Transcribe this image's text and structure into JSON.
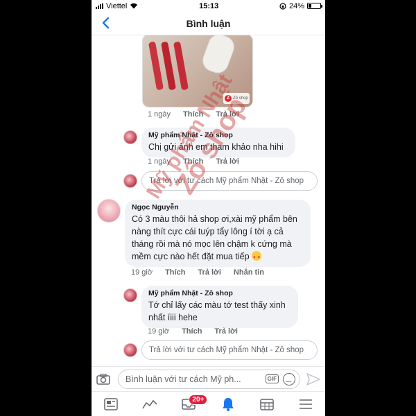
{
  "status_bar": {
    "carrier": "Viettel",
    "time": "15:13",
    "battery": "24%",
    "battery_level": 0.24
  },
  "header": {
    "title": "Bình luận"
  },
  "photo_comment": {
    "time": "1 ngày",
    "like": "Thích",
    "reply": "Trả lời",
    "badge_text": "Zô shop"
  },
  "comments": [
    {
      "author": "Mỹ phẩm Nhật - Zô shop",
      "text": "Chị gửi ảnh em tham khảo nha hihi",
      "time": "1 ngày",
      "like": "Thích",
      "reply": "Trả lời"
    },
    {
      "author": "Ngọc Nguyễn",
      "text": "Có 3 màu thôi hả shop ơi,xài mỹ phẩm bên nàng thít cực cái tuýp tẩy lông í tời ạ cả tháng rồi mà nó mọc lên chậm k cứng mà mềm cực nào hết đặt mua tiếp",
      "time": "19 giờ",
      "like": "Thích",
      "reply": "Trả lời",
      "message": "Nhắn tin"
    },
    {
      "author": "Mỹ phẩm Nhật - Zô shop",
      "text": "Tớ chỉ lấy các màu tớ test thấy xinh nhất íiii hehe",
      "time": "19 giờ",
      "like": "Thích",
      "reply": "Trả lời"
    }
  ],
  "reply_placeholder": "Trả lời với tư cách Mỹ phẩm Nhật - Zô shop",
  "composer": {
    "placeholder": "Bình luận với tư cách Mỹ ph...",
    "gif": "GIF"
  },
  "tabbar": {
    "notification_badge": "20+"
  },
  "watermark": {
    "line1": "Mỹ phẩm Nhật",
    "line2": "Zô shop"
  },
  "colors": {
    "accent": "#1877f2",
    "badge": "#e41e3f",
    "watermark": "#c83c3c"
  }
}
